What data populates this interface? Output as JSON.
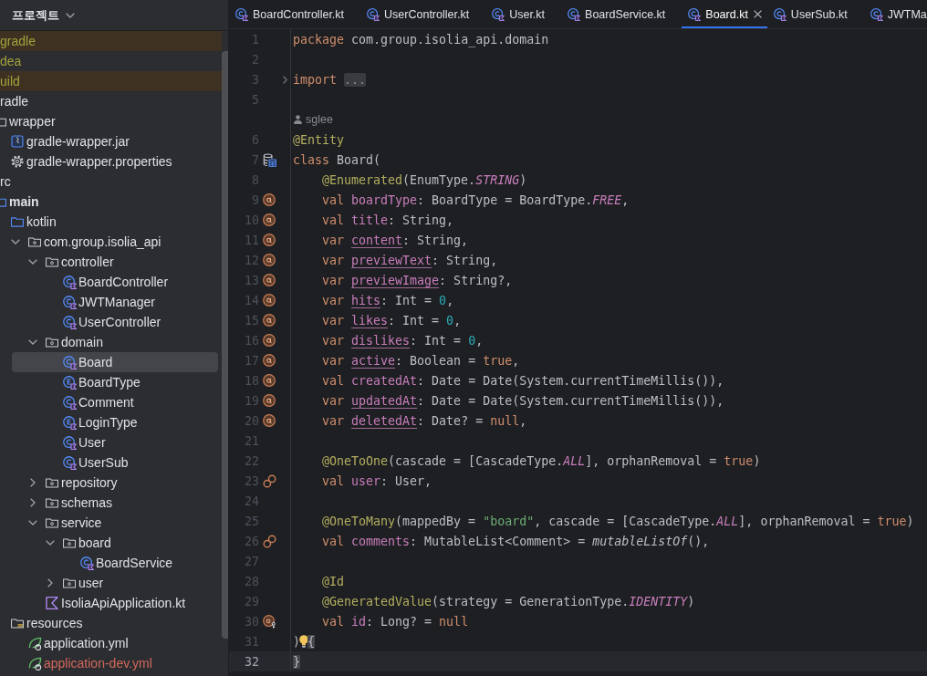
{
  "project_panel": {
    "title": "프로젝트",
    "tree": [
      {
        "label": "gradle",
        "excluded": true,
        "ignored": true,
        "selected": false
      },
      {
        "label": "dea",
        "ignored": true,
        "selected": false
      },
      {
        "label": "uild",
        "excluded": true,
        "ignored": true,
        "selected": false
      },
      {
        "label": "radle",
        "selected": false,
        "children": [
          {
            "label": "wrapper",
            "kind": "folder",
            "selected": false,
            "children": [
              {
                "label": "gradle-wrapper.jar",
                "kind": "archive",
                "selected": false
              },
              {
                "label": "gradle-wrapper.properties",
                "kind": "properties",
                "selected": false
              }
            ]
          }
        ]
      },
      {
        "label": "rc",
        "selected": false,
        "children": [
          {
            "label": "main",
            "kind": "module",
            "selected": false,
            "children": [
              {
                "label": "kotlin",
                "kind": "source-root",
                "selected": false,
                "children": [
                  {
                    "label": "com.group.isolia_api",
                    "kind": "package",
                    "expanded": true,
                    "selected": false,
                    "children": [
                      {
                        "label": "controller",
                        "kind": "package",
                        "expanded": true,
                        "selected": false,
                        "children": [
                          {
                            "label": "BoardController",
                            "kind": "class",
                            "selected": false
                          },
                          {
                            "label": "JWTManager",
                            "kind": "class",
                            "selected": false
                          },
                          {
                            "label": "UserController",
                            "kind": "class",
                            "selected": false
                          }
                        ]
                      },
                      {
                        "label": "domain",
                        "kind": "package",
                        "expanded": true,
                        "selected": false,
                        "children": [
                          {
                            "label": "Board",
                            "kind": "class",
                            "selected": true
                          },
                          {
                            "label": "BoardType",
                            "kind": "enum",
                            "selected": false
                          },
                          {
                            "label": "Comment",
                            "kind": "class",
                            "selected": false
                          },
                          {
                            "label": "LoginType",
                            "kind": "enum",
                            "selected": false
                          },
                          {
                            "label": "User",
                            "kind": "class",
                            "selected": false
                          },
                          {
                            "label": "UserSub",
                            "kind": "class",
                            "selected": false
                          }
                        ]
                      },
                      {
                        "label": "repository",
                        "kind": "package",
                        "expanded": false,
                        "selected": false
                      },
                      {
                        "label": "schemas",
                        "kind": "package",
                        "expanded": false,
                        "selected": false
                      },
                      {
                        "label": "service",
                        "kind": "package",
                        "expanded": true,
                        "selected": false,
                        "children": [
                          {
                            "label": "board",
                            "kind": "package",
                            "expanded": true,
                            "selected": false,
                            "children": [
                              {
                                "label": "BoardService",
                                "kind": "class",
                                "selected": false
                              }
                            ]
                          },
                          {
                            "label": "user",
                            "kind": "package",
                            "expanded": false,
                            "selected": false
                          }
                        ]
                      },
                      {
                        "label": "IsoliaApiApplication.kt",
                        "kind": "kotlin-file",
                        "selected": false
                      }
                    ]
                  }
                ]
              },
              {
                "label": "resources",
                "kind": "resources-root",
                "selected": false,
                "children": [
                  {
                    "label": "application.yml",
                    "kind": "spring-config",
                    "selected": false
                  },
                  {
                    "label": "application-dev.yml",
                    "kind": "spring-config",
                    "unversioned": true,
                    "selected": false
                  }
                ]
              }
            ]
          }
        ]
      }
    ]
  },
  "editor": {
    "tabs": [
      {
        "label": "BoardController.kt",
        "selected": false
      },
      {
        "label": "UserController.kt",
        "selected": false
      },
      {
        "label": "User.kt",
        "selected": false
      },
      {
        "label": "BoardService.kt",
        "selected": false
      },
      {
        "label": "Board.kt",
        "selected": true
      },
      {
        "label": "UserSub.kt",
        "selected": false
      },
      {
        "label": "JWTMa",
        "selected": false
      }
    ],
    "lines": [
      {
        "kind": "code",
        "number": "1",
        "current": false,
        "tokens": [
          {
            "text": "package",
            "kind": "keyword"
          },
          {
            "text": " com.group.isolia_api.domain",
            "kind": "plain"
          }
        ]
      },
      {
        "kind": "code",
        "number": "2",
        "current": false
      },
      {
        "kind": "code",
        "number": "3",
        "current": false,
        "folded": true,
        "tokens": [
          {
            "text": "import ",
            "kind": "keyword"
          },
          {
            "text": "...",
            "kind": "folded"
          }
        ]
      },
      {
        "kind": "code",
        "number": "5",
        "current": false
      },
      {
        "kind": "author",
        "text": "sglee"
      },
      {
        "kind": "code",
        "number": "6",
        "current": false,
        "tokens": [
          {
            "text": "@Entity",
            "kind": "annotation"
          }
        ]
      },
      {
        "kind": "code",
        "number": "7",
        "current": false,
        "gutter_marker": {
          "kind": "table"
        },
        "tokens": [
          {
            "text": "class ",
            "kind": "keyword"
          },
          {
            "text": "Board(",
            "kind": "plain"
          }
        ],
        "children": [
          {
            "kind": "code",
            "number": "8",
            "current": false,
            "tokens": [
              {
                "text": "@Enumerated",
                "kind": "annotation"
              },
              {
                "text": "(EnumType.",
                "kind": "plain"
              },
              {
                "text": "STRING",
                "kind": "constant"
              },
              {
                "text": ")",
                "kind": "plain"
              }
            ]
          },
          {
            "kind": "code",
            "number": "9",
            "current": false,
            "gutter_marker": {
              "kind": "column"
            },
            "tokens": [
              {
                "text": "val ",
                "kind": "keyword"
              },
              {
                "text": "boardType",
                "kind": "property"
              },
              {
                "text": ": BoardType = BoardType.",
                "kind": "plain"
              },
              {
                "text": "FREE",
                "kind": "constant"
              },
              {
                "text": ",",
                "kind": "plain"
              }
            ]
          },
          {
            "kind": "code",
            "number": "10",
            "current": false,
            "gutter_marker": {
              "kind": "column"
            },
            "tokens": [
              {
                "text": "val ",
                "kind": "keyword"
              },
              {
                "text": "title",
                "kind": "property"
              },
              {
                "text": ": String,",
                "kind": "plain"
              }
            ]
          },
          {
            "kind": "code",
            "number": "11",
            "current": false,
            "gutter_marker": {
              "kind": "column"
            },
            "tokens": [
              {
                "text": "var ",
                "kind": "keyword"
              },
              {
                "text": "content",
                "kind": "mutable-property"
              },
              {
                "text": ": String,",
                "kind": "plain"
              }
            ]
          },
          {
            "kind": "code",
            "number": "12",
            "current": false,
            "gutter_marker": {
              "kind": "column"
            },
            "tokens": [
              {
                "text": "var ",
                "kind": "keyword"
              },
              {
                "text": "previewText",
                "kind": "mutable-property"
              },
              {
                "text": ": String,",
                "kind": "plain"
              }
            ]
          },
          {
            "kind": "code",
            "number": "13",
            "current": false,
            "gutter_marker": {
              "kind": "column"
            },
            "tokens": [
              {
                "text": "var ",
                "kind": "keyword"
              },
              {
                "text": "previewImage",
                "kind": "mutable-property"
              },
              {
                "text": ": String?,",
                "kind": "plain"
              }
            ]
          },
          {
            "kind": "code",
            "number": "14",
            "current": false,
            "gutter_marker": {
              "kind": "column"
            },
            "tokens": [
              {
                "text": "var ",
                "kind": "keyword"
              },
              {
                "text": "hits",
                "kind": "mutable-property"
              },
              {
                "text": ": Int = ",
                "kind": "plain"
              },
              {
                "text": "0",
                "kind": "number"
              },
              {
                "text": ",",
                "kind": "plain"
              }
            ]
          },
          {
            "kind": "code",
            "number": "15",
            "current": false,
            "gutter_marker": {
              "kind": "column"
            },
            "tokens": [
              {
                "text": "var ",
                "kind": "keyword"
              },
              {
                "text": "likes",
                "kind": "mutable-property"
              },
              {
                "text": ": Int = ",
                "kind": "plain"
              },
              {
                "text": "0",
                "kind": "number"
              },
              {
                "text": ",",
                "kind": "plain"
              }
            ]
          },
          {
            "kind": "code",
            "number": "16",
            "current": false,
            "gutter_marker": {
              "kind": "column"
            },
            "tokens": [
              {
                "text": "var ",
                "kind": "keyword"
              },
              {
                "text": "dislikes",
                "kind": "mutable-property"
              },
              {
                "text": ": Int = ",
                "kind": "plain"
              },
              {
                "text": "0",
                "kind": "number"
              },
              {
                "text": ",",
                "kind": "plain"
              }
            ]
          },
          {
            "kind": "code",
            "number": "17",
            "current": false,
            "gutter_marker": {
              "kind": "column"
            },
            "tokens": [
              {
                "text": "var ",
                "kind": "keyword"
              },
              {
                "text": "active",
                "kind": "mutable-property"
              },
              {
                "text": ": Boolean = ",
                "kind": "plain"
              },
              {
                "text": "true",
                "kind": "keyword"
              },
              {
                "text": ",",
                "kind": "plain"
              }
            ]
          },
          {
            "kind": "code",
            "number": "18",
            "current": false,
            "gutter_marker": {
              "kind": "column"
            },
            "tokens": [
              {
                "text": "val ",
                "kind": "keyword"
              },
              {
                "text": "createdAt",
                "kind": "property"
              },
              {
                "text": ": Date = Date(System.currentTimeMillis()),",
                "kind": "plain"
              }
            ]
          },
          {
            "kind": "code",
            "number": "19",
            "current": false,
            "gutter_marker": {
              "kind": "column"
            },
            "tokens": [
              {
                "text": "var ",
                "kind": "keyword"
              },
              {
                "text": "updatedAt",
                "kind": "mutable-property"
              },
              {
                "text": ": Date = Date(System.currentTimeMillis()),",
                "kind": "plain"
              }
            ]
          },
          {
            "kind": "code",
            "number": "20",
            "current": false,
            "gutter_marker": {
              "kind": "column"
            },
            "tokens": [
              {
                "text": "var ",
                "kind": "keyword"
              },
              {
                "text": "deletedAt",
                "kind": "mutable-property"
              },
              {
                "text": ": Date? = ",
                "kind": "plain"
              },
              {
                "text": "null",
                "kind": "keyword"
              },
              {
                "text": ",",
                "kind": "plain"
              }
            ]
          },
          {
            "kind": "code",
            "number": "21",
            "current": false
          },
          {
            "kind": "code",
            "number": "22",
            "current": false,
            "tokens": [
              {
                "text": "@OneToOne",
                "kind": "annotation"
              },
              {
                "text": "(cascade = [CascadeType.",
                "kind": "plain"
              },
              {
                "text": "ALL",
                "kind": "constant"
              },
              {
                "text": "], orphanRemoval = ",
                "kind": "plain"
              },
              {
                "text": "true",
                "kind": "keyword"
              },
              {
                "text": ")",
                "kind": "plain"
              }
            ]
          },
          {
            "kind": "code",
            "number": "23",
            "current": false,
            "gutter_marker": {
              "kind": "relation"
            },
            "tokens": [
              {
                "text": "val ",
                "kind": "keyword"
              },
              {
                "text": "user",
                "kind": "property"
              },
              {
                "text": ": User,",
                "kind": "plain"
              }
            ]
          },
          {
            "kind": "code",
            "number": "24",
            "current": false
          },
          {
            "kind": "code",
            "number": "25",
            "current": false,
            "tokens": [
              {
                "text": "@OneToMany",
                "kind": "annotation"
              },
              {
                "text": "(mappedBy = ",
                "kind": "plain"
              },
              {
                "text": "\"board\"",
                "kind": "string"
              },
              {
                "text": ", cascade = [CascadeType.",
                "kind": "plain"
              },
              {
                "text": "ALL",
                "kind": "constant"
              },
              {
                "text": "], orphanRemoval = ",
                "kind": "plain"
              },
              {
                "text": "true",
                "kind": "keyword"
              },
              {
                "text": ")",
                "kind": "plain"
              }
            ]
          },
          {
            "kind": "code",
            "number": "26",
            "current": false,
            "gutter_marker": {
              "kind": "relation"
            },
            "tokens": [
              {
                "text": "val ",
                "kind": "keyword"
              },
              {
                "text": "comments",
                "kind": "property"
              },
              {
                "text": ": MutableList<Comment> = ",
                "kind": "plain"
              },
              {
                "text": "mutableListOf",
                "kind": "call"
              },
              {
                "text": "(),",
                "kind": "plain"
              }
            ]
          },
          {
            "kind": "code",
            "number": "27",
            "current": false
          },
          {
            "kind": "code",
            "number": "28",
            "current": false,
            "tokens": [
              {
                "text": "@Id",
                "kind": "annotation"
              }
            ]
          },
          {
            "kind": "code",
            "number": "29",
            "current": false,
            "tokens": [
              {
                "text": "@GeneratedValue",
                "kind": "annotation"
              },
              {
                "text": "(strategy = GenerationType.",
                "kind": "plain"
              },
              {
                "text": "IDENTITY",
                "kind": "constant"
              },
              {
                "text": ")",
                "kind": "plain"
              }
            ]
          },
          {
            "kind": "code",
            "number": "30",
            "current": false,
            "gutter_marker": {
              "kind": "id"
            },
            "tokens": [
              {
                "text": "val ",
                "kind": "keyword"
              },
              {
                "text": "id",
                "kind": "property"
              },
              {
                "text": ": Long? = ",
                "kind": "plain"
              },
              {
                "text": "null",
                "kind": "keyword"
              }
            ]
          }
        ]
      },
      {
        "kind": "code",
        "number": "31",
        "current": false,
        "tokens": [
          {
            "text": ")",
            "kind": "plain"
          },
          {
            "kind": "bulb"
          },
          {
            "text": "{",
            "kind": "brace-match"
          }
        ]
      },
      {
        "kind": "code",
        "number": "32",
        "current": true,
        "tokens": [
          {
            "text": "}",
            "kind": "brace-match"
          }
        ]
      }
    ]
  }
}
